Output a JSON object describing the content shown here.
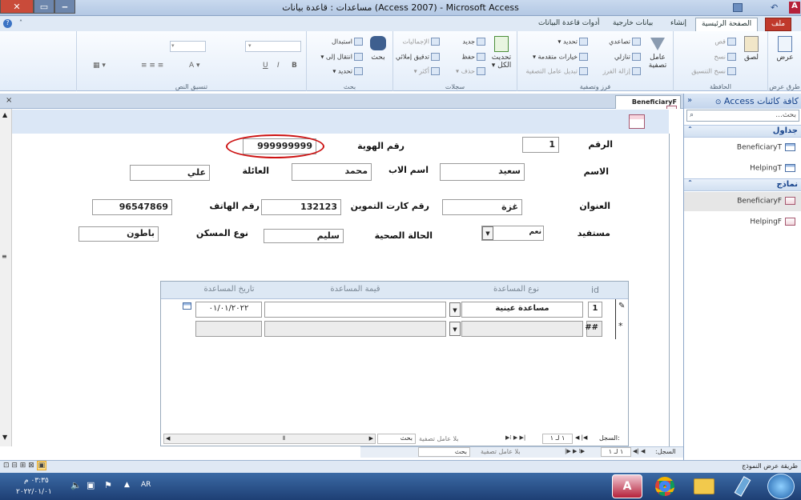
{
  "window": {
    "title": "مساعدات : قاعدة بيانات (Access 2007) - Microsoft Access",
    "app_letter": "A"
  },
  "ribbon_tabs": [
    "ملف",
    "الصفحة الرئيسية",
    "إنشاء",
    "بيانات خارجية",
    "أدوات قاعدة البيانات"
  ],
  "ribbon": {
    "views": {
      "label": "طرق عرض",
      "view": "عرض"
    },
    "clipboard": {
      "label": "الحافظة",
      "paste": "لصق",
      "cut": "قص",
      "copy": "نسخ",
      "format_painter": "نسخ التنسيق"
    },
    "sort_filter": {
      "label": "فرز وتصفية",
      "filter": "عامل تصفية",
      "ascending": "تصاعدي",
      "descending": "تنازلي",
      "remove_sort": "إزالة الفرز",
      "selection": "تحديد",
      "advanced": "خيارات متقدمة",
      "toggle_filter": "تبديل عامل التصفية"
    },
    "records": {
      "label": "سجلات",
      "refresh": "تحديث الكل",
      "new": "جديد",
      "save": "حفظ",
      "delete": "حذف",
      "totals": "الإجماليات",
      "spelling": "تدقيق إملائي",
      "more": "أكثر"
    },
    "find": {
      "label": "بحث",
      "find": "بحث",
      "replace": "استبدال",
      "goto": "انتقال إلى",
      "select": "تحديد"
    },
    "text_format": {
      "label": "تنسيق النص"
    }
  },
  "nav_pane": {
    "title": "كافة كائنات Access",
    "search_placeholder": "بحث...",
    "groups": [
      {
        "name": "جداول",
        "items": [
          "BeneficiaryT",
          "HelpingT"
        ]
      },
      {
        "name": "نماذج",
        "items": [
          "BeneficiaryF",
          "HelpingF"
        ]
      }
    ]
  },
  "document_tab": "BeneficiaryF",
  "form": {
    "labels": {
      "number": "الرقم",
      "id_number": "رقم الهوية",
      "name": "الاسم",
      "father_name": "اسم الاب",
      "family": "العائلة",
      "address": "العنوان",
      "ration_card": "رقم كارت التموين",
      "phone": "رقم الهاتف",
      "beneficiary": "مستفيد",
      "health_status": "الحالة الصحية",
      "housing_type": "نوع المسكن"
    },
    "values": {
      "number": "1",
      "id_number": "999999999",
      "name": "سعيد",
      "father_name": "محمد",
      "family": "علي",
      "address": "غزة",
      "ration_card": "132123",
      "phone": "96547869",
      "beneficiary": "نعم",
      "health_status": "سليم",
      "housing_type": "باطون"
    }
  },
  "subform": {
    "columns": [
      "id",
      "نوع المساعدة",
      "قيمة المساعدة",
      "تاريخ المساعدة"
    ],
    "rows": [
      {
        "id": "1",
        "type": "مساعدة عينية",
        "value": "",
        "date": "٠١/٠١/٢٠٢٢"
      }
    ],
    "new_row_id": "##",
    "record_nav": {
      "label": "السجل:",
      "position": "١ لـ ١",
      "filter": "بلا عامل تصفية",
      "search": "بحث"
    }
  },
  "main_record_nav": {
    "label": "السجل:",
    "position": "١ لـ ١",
    "filter": "بلا عامل تصفية",
    "search": "بحث"
  },
  "status": {
    "left_text": "طريقة عرض النموذج"
  },
  "taskbar": {
    "lang": "AR",
    "time": "٠٣:٣٥ م",
    "date": "٢٠٢٢/٠١/٠١"
  },
  "colors": {
    "title_bar": "#b3c8e4",
    "file_tab": "#c0392b",
    "form_header": "#dbe7f6",
    "annotation": "#cc1111"
  }
}
